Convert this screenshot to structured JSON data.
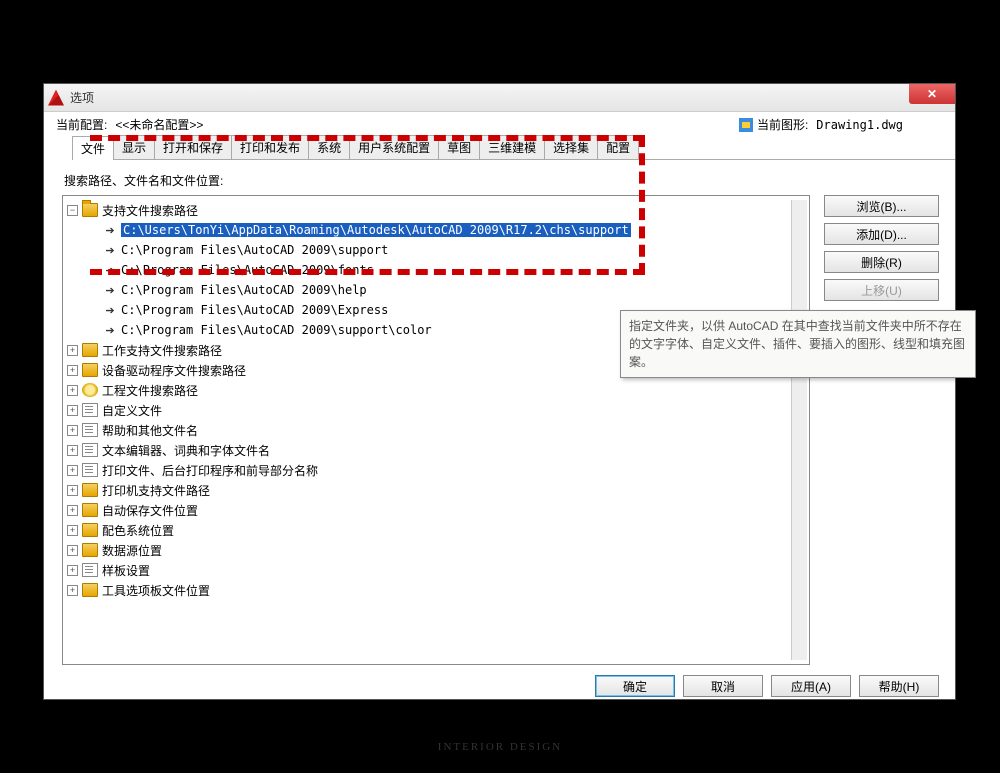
{
  "title": "选项",
  "header": {
    "profile_label": "当前配置:",
    "profile_value": "<<未命名配置>>",
    "drawing_label": "当前图形:",
    "drawing_value": "Drawing1.dwg"
  },
  "tabs": [
    "文件",
    "显示",
    "打开和保存",
    "打印和发布",
    "系统",
    "用户系统配置",
    "草图",
    "三维建模",
    "选择集",
    "配置"
  ],
  "active_tab": 0,
  "body_label": "搜索路径、文件名和文件位置:",
  "tree": {
    "root_open": {
      "label": "支持文件搜索路径"
    },
    "paths": [
      "C:\\Users\\TonYi\\AppData\\Roaming\\Autodesk\\AutoCAD 2009\\R17.2\\chs\\support",
      "C:\\Program Files\\AutoCAD 2009\\support",
      "C:\\Program Files\\AutoCAD 2009\\fonts",
      "C:\\Program Files\\AutoCAD 2009\\help",
      "C:\\Program Files\\AutoCAD 2009\\Express",
      "C:\\Program Files\\AutoCAD 2009\\support\\color"
    ],
    "others": [
      {
        "label": "工作支持文件搜索路径",
        "icon": "folder"
      },
      {
        "label": "设备驱动程序文件搜索路径",
        "icon": "folder"
      },
      {
        "label": "工程文件搜索路径",
        "icon": "engine"
      },
      {
        "label": "自定义文件",
        "icon": "file"
      },
      {
        "label": "帮助和其他文件名",
        "icon": "file"
      },
      {
        "label": "文本编辑器、词典和字体文件名",
        "icon": "file"
      },
      {
        "label": "打印文件、后台打印程序和前导部分名称",
        "icon": "file"
      },
      {
        "label": "打印机支持文件路径",
        "icon": "folder"
      },
      {
        "label": "自动保存文件位置",
        "icon": "folder"
      },
      {
        "label": "配色系统位置",
        "icon": "folder"
      },
      {
        "label": "数据源位置",
        "icon": "folder"
      },
      {
        "label": "样板设置",
        "icon": "file"
      },
      {
        "label": "工具选项板文件位置",
        "icon": "folder"
      }
    ]
  },
  "side_buttons": {
    "browse": "浏览(B)...",
    "add": "添加(D)...",
    "delete": "删除(R)",
    "moveup": "上移(U)"
  },
  "footer": {
    "ok": "确定",
    "cancel": "取消",
    "apply": "应用(A)",
    "help": "帮助(H)"
  },
  "tooltip": "指定文件夹，以供 AutoCAD 在其中查找当前文件夹中所不存在的文字字体、自定义文件、插件、要插入的图形、线型和填充图案。",
  "watermark": "INTERIOR DESIGN"
}
